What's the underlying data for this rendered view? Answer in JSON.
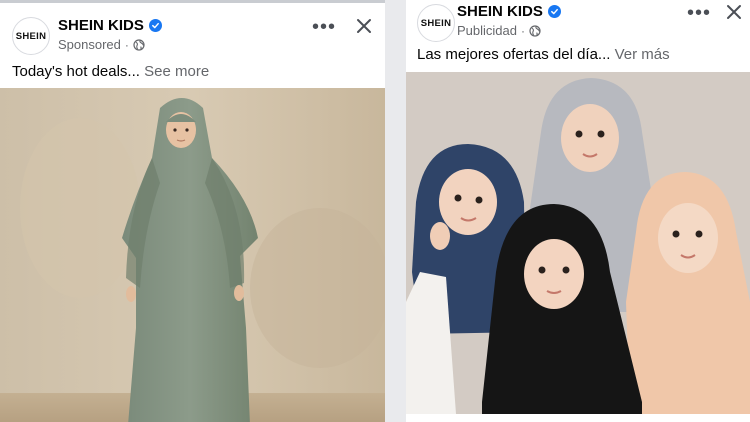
{
  "ads": [
    {
      "logo_text": "SHEIN",
      "brand": "SHEIN KIDS",
      "sponsored": "Sponsored",
      "caption": "Today's hot deals...",
      "see_more": "See more"
    },
    {
      "logo_text": "SHEIN",
      "brand": "SHEIN KIDS",
      "sponsored": "Publicidad",
      "caption": "Las mejores ofertas del día...",
      "see_more": "Ver más"
    }
  ],
  "icons": {
    "verified": "verified-badge-icon",
    "globe": "globe-icon",
    "more": "more-options-icon",
    "close": "close-icon"
  },
  "colors": {
    "verified_blue": "#1877f2",
    "secondary_text": "#65676b"
  }
}
